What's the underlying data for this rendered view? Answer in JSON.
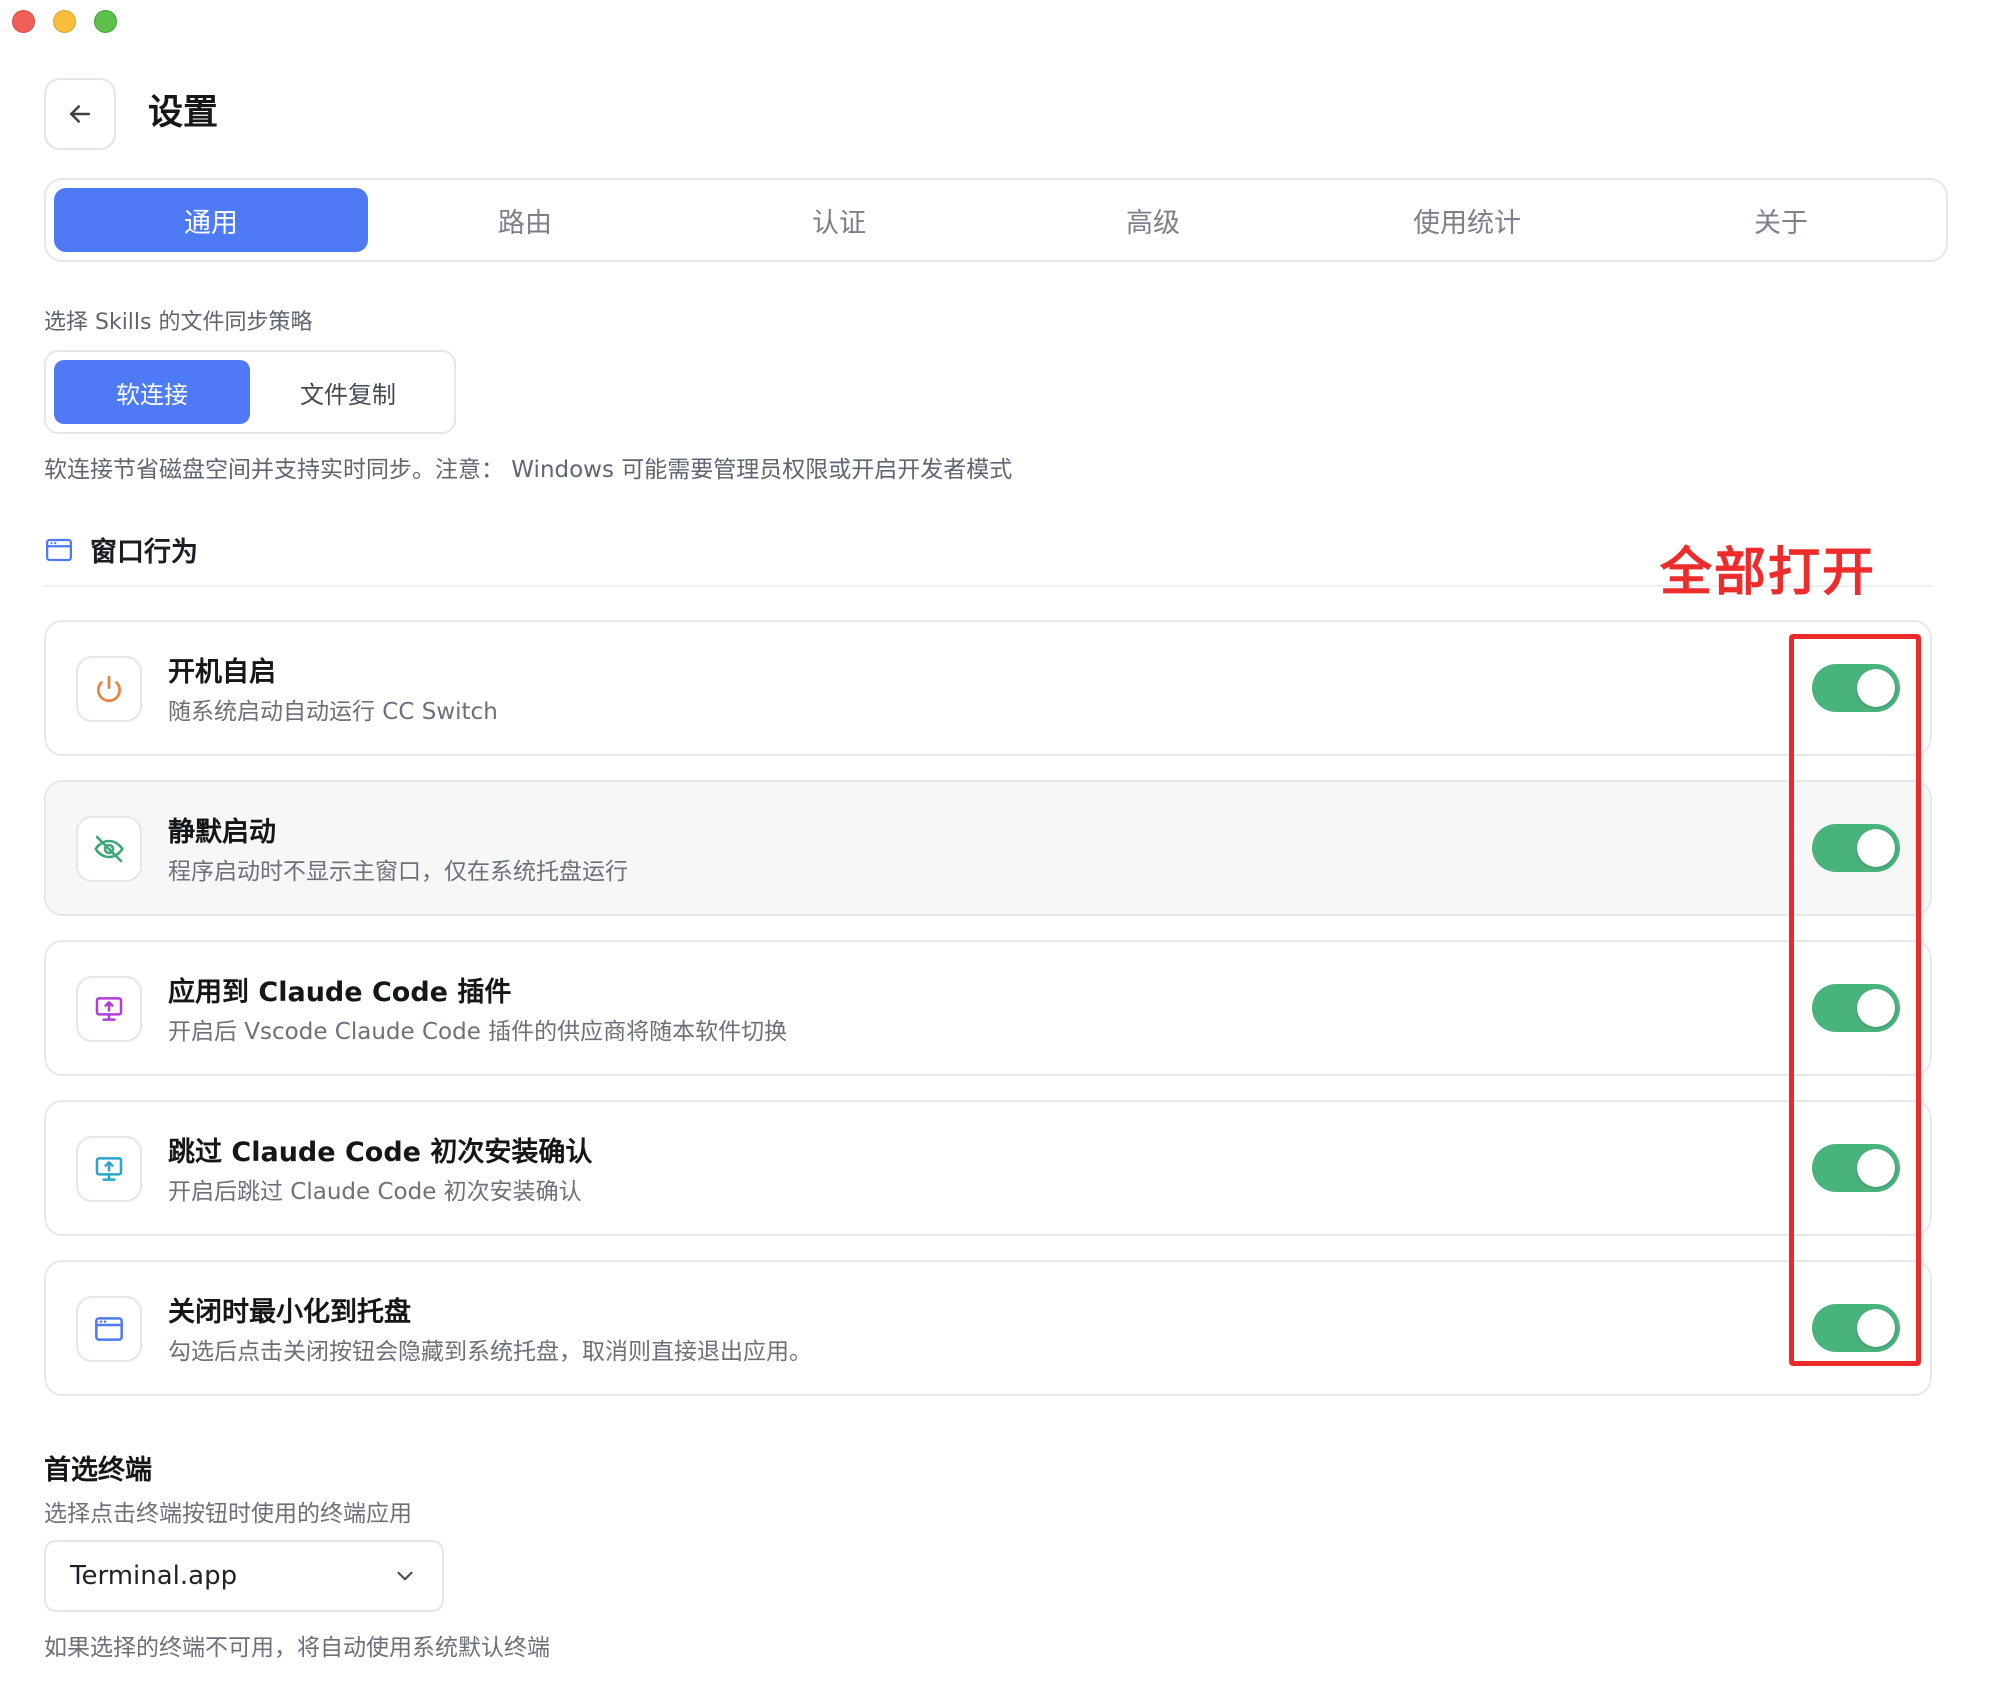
{
  "header": {
    "title": "设置"
  },
  "tabs": [
    {
      "label": "通用",
      "active": true
    },
    {
      "label": "路由",
      "active": false
    },
    {
      "label": "认证",
      "active": false
    },
    {
      "label": "高级",
      "active": false
    },
    {
      "label": "使用统计",
      "active": false
    },
    {
      "label": "关于",
      "active": false
    }
  ],
  "skills": {
    "label": "选择 Skills 的文件同步策略",
    "options": [
      "软连接",
      "文件复制"
    ],
    "selected": "软连接",
    "hint": "软连接节省磁盘空间并支持实时同步。注意： Windows 可能需要管理员权限或开启开发者模式"
  },
  "window_behavior": {
    "title": "窗口行为",
    "annotation": "全部打开",
    "items": [
      {
        "title": "开机自启",
        "desc": "随系统启动自动运行 CC Switch",
        "icon": "power-icon",
        "enabled": true
      },
      {
        "title": "静默启动",
        "desc": "程序启动时不显示主窗口，仅在系统托盘运行",
        "icon": "eye-off-icon",
        "enabled": true
      },
      {
        "title": "应用到 Claude Code 插件",
        "desc": "开启后 Vscode Claude Code 插件的供应商将随本软件切换",
        "icon": "monitor-upload-icon",
        "enabled": true
      },
      {
        "title": "跳过 Claude Code 初次安装确认",
        "desc": "开启后跳过 Claude Code 初次安装确认",
        "icon": "monitor-upload-icon",
        "enabled": true
      },
      {
        "title": "关闭时最小化到托盘",
        "desc": "勾选后点击关闭按钮会隐藏到系统托盘，取消则直接退出应用。",
        "icon": "window-icon",
        "enabled": true
      }
    ]
  },
  "terminal": {
    "title": "首选终端",
    "subtitle": "选择点击终端按钮时使用的终端应用",
    "selected": "Terminal.app",
    "note": "如果选择的终端不可用，将自动使用系统默认终端"
  },
  "colors": {
    "accent": "#4f7af5",
    "toggle_on": "#49b37c",
    "annotation": "#ec2a2a"
  }
}
